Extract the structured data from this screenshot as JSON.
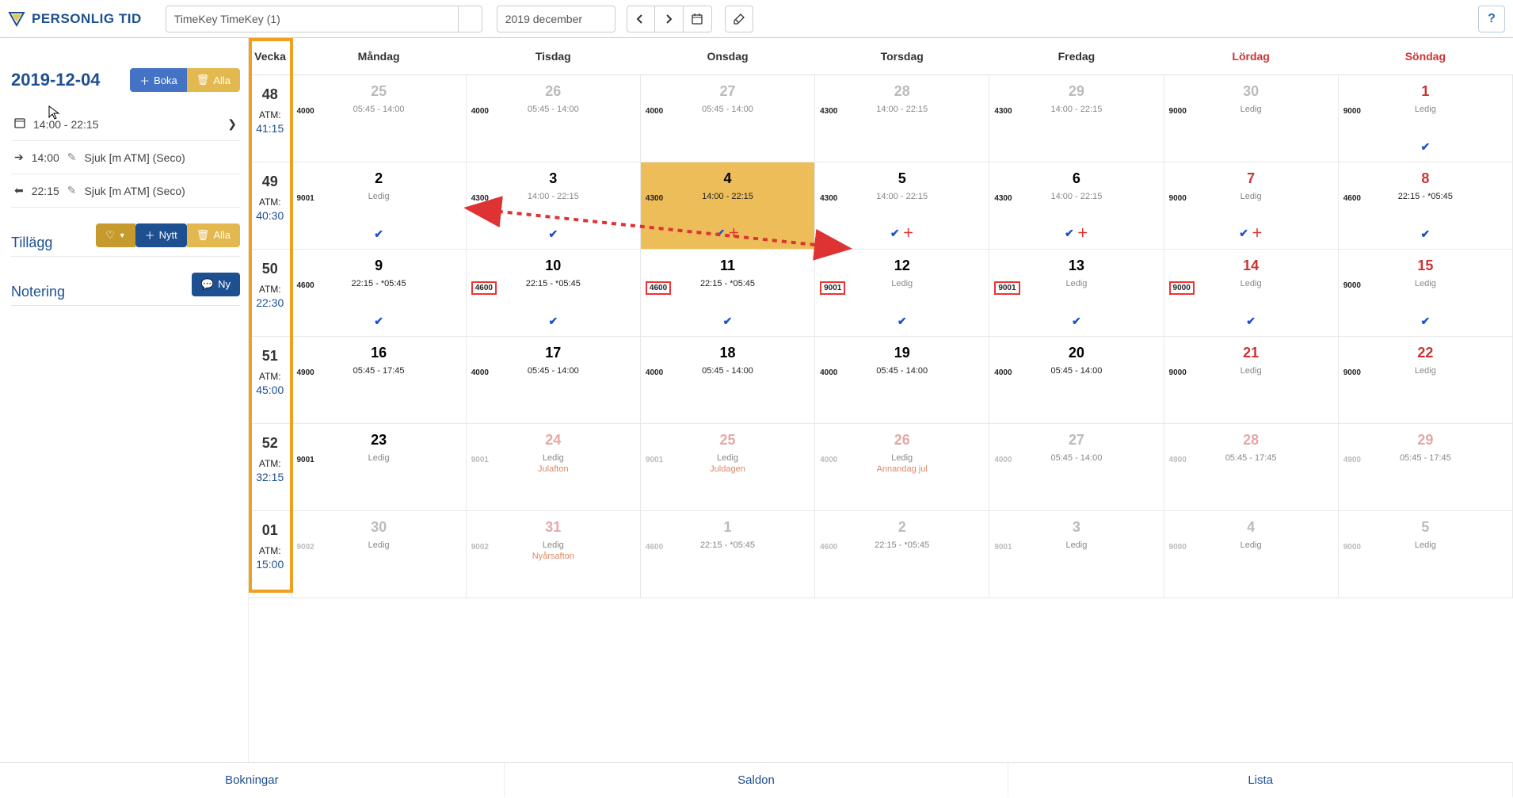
{
  "app_title": "PERSONLIG TID",
  "search_value": "TimeKey TimeKey (1)",
  "month_picker": "2019 december",
  "help_icon": "?",
  "sidebar": {
    "date": "2019-12-04",
    "boka_btn": "Boka",
    "alla_btn": "Alla",
    "schedule_row": "14:00 - 22:15",
    "in_time": "14:00",
    "in_text": "Sjuk [m ATM] (Seco)",
    "out_time": "22:15",
    "out_text": "Sjuk [m ATM] (Seco)",
    "tillagg_label": "Tillägg",
    "nytt_btn": "Nytt",
    "alla2_btn": "Alla",
    "notering_label": "Notering",
    "ny_btn": "Ny"
  },
  "headers": {
    "vecka": "Vecka",
    "days": [
      "Måndag",
      "Tisdag",
      "Onsdag",
      "Torsdag",
      "Fredag",
      "Lördag",
      "Söndag"
    ]
  },
  "weeks": [
    {
      "num": "48",
      "atm": "41:15",
      "cells": [
        {
          "day": "25",
          "dim": true,
          "code": "4000",
          "time": "05:45 - 14:00"
        },
        {
          "day": "26",
          "dim": true,
          "code": "4000",
          "time": "05:45 - 14:00"
        },
        {
          "day": "27",
          "dim": true,
          "code": "4000",
          "time": "05:45 - 14:00"
        },
        {
          "day": "28",
          "dim": true,
          "code": "4300",
          "time": "14:00 - 22:15"
        },
        {
          "day": "29",
          "dim": true,
          "code": "4300",
          "time": "14:00 - 22:15"
        },
        {
          "day": "30",
          "dim": true,
          "code": "9000",
          "time": "Ledig"
        },
        {
          "day": "1",
          "red": true,
          "code": "9000",
          "time": "Ledig",
          "check": true
        }
      ]
    },
    {
      "num": "49",
      "atm": "40:30",
      "cells": [
        {
          "day": "2",
          "code": "9001",
          "time": "Ledig",
          "check": true
        },
        {
          "day": "3",
          "code": "4300",
          "time": "14:00 - 22:15",
          "check": true
        },
        {
          "day": "4",
          "code": "4300",
          "time": "14:00 - 22:15",
          "check": true,
          "plus": true,
          "selected": true,
          "dk": true
        },
        {
          "day": "5",
          "code": "4300",
          "time": "14:00 - 22:15",
          "check": true,
          "plus": true
        },
        {
          "day": "6",
          "code": "4300",
          "time": "14:00 - 22:15",
          "check": true,
          "plus": true
        },
        {
          "day": "7",
          "red": true,
          "code": "9000",
          "time": "Ledig",
          "check": true,
          "plus": true
        },
        {
          "day": "8",
          "red": true,
          "code": "4600",
          "time": "22:15 - *05:45",
          "check": true,
          "dk": true
        }
      ]
    },
    {
      "num": "50",
      "atm": "22:30",
      "cells": [
        {
          "day": "9",
          "code": "4600",
          "time": "22:15 - *05:45",
          "check": true,
          "dk": true
        },
        {
          "day": "10",
          "code": "4600",
          "boxed": true,
          "time": "22:15 - *05:45",
          "check": true,
          "dk": true
        },
        {
          "day": "11",
          "code": "4600",
          "boxed": true,
          "time": "22:15 - *05:45",
          "check": true,
          "dk": true
        },
        {
          "day": "12",
          "code": "9001",
          "boxed": true,
          "time": "Ledig",
          "check": true
        },
        {
          "day": "13",
          "code": "9001",
          "boxed": true,
          "time": "Ledig",
          "check": true
        },
        {
          "day": "14",
          "red": true,
          "code": "9000",
          "boxed": true,
          "time": "Ledig",
          "check": true
        },
        {
          "day": "15",
          "red": true,
          "code": "9000",
          "time": "Ledig",
          "check": true
        }
      ]
    },
    {
      "num": "51",
      "atm": "45:00",
      "cells": [
        {
          "day": "16",
          "code": "4900",
          "time": "05:45 - 17:45",
          "dk": true
        },
        {
          "day": "17",
          "code": "4000",
          "time": "05:45 - 14:00",
          "dk": true
        },
        {
          "day": "18",
          "code": "4000",
          "time": "05:45 - 14:00",
          "dk": true
        },
        {
          "day": "19",
          "code": "4000",
          "time": "05:45 - 14:00",
          "dk": true
        },
        {
          "day": "20",
          "code": "4000",
          "time": "05:45 - 14:00",
          "dk": true
        },
        {
          "day": "21",
          "red": true,
          "code": "9000",
          "time": "Ledig"
        },
        {
          "day": "22",
          "red": true,
          "code": "9000",
          "time": "Ledig"
        }
      ]
    },
    {
      "num": "52",
      "atm": "32:15",
      "cells": [
        {
          "day": "23",
          "code": "9001",
          "time": "Ledig"
        },
        {
          "day": "24",
          "dimred": true,
          "code": "9001",
          "cdim": true,
          "time": "Ledig",
          "extra": "Julafton",
          "tdim": true
        },
        {
          "day": "25",
          "dimred": true,
          "code": "9001",
          "cdim": true,
          "time": "Ledig",
          "extra": "Juldagen",
          "tdim": true
        },
        {
          "day": "26",
          "dimred": true,
          "code": "4000",
          "cdim": true,
          "time": "Ledig",
          "extra": "Annandag jul",
          "tdim": true
        },
        {
          "day": "27",
          "dim": true,
          "code": "4000",
          "cdim": true,
          "time": "05:45 - 14:00"
        },
        {
          "day": "28",
          "dimred": true,
          "code": "4900",
          "cdim": true,
          "time": "05:45 - 17:45"
        },
        {
          "day": "29",
          "dimred": true,
          "code": "4900",
          "cdim": true,
          "time": "05:45 - 17:45"
        }
      ]
    },
    {
      "num": "01",
      "atm": "15:00",
      "cells": [
        {
          "day": "30",
          "dim": true,
          "code": "9002",
          "cdim": true,
          "time": "Ledig"
        },
        {
          "day": "31",
          "dimred": true,
          "code": "9002",
          "cdim": true,
          "time": "Ledig",
          "extra": "Nyårsafton",
          "tdim": true
        },
        {
          "day": "1",
          "dim": true,
          "code": "4600",
          "cdim": true,
          "time": "22:15 - *05:45"
        },
        {
          "day": "2",
          "dim": true,
          "code": "4600",
          "cdim": true,
          "time": "22:15 - *05:45"
        },
        {
          "day": "3",
          "dim": true,
          "code": "9001",
          "cdim": true,
          "time": "Ledig"
        },
        {
          "day": "4",
          "dim": true,
          "code": "9000",
          "cdim": true,
          "time": "Ledig"
        },
        {
          "day": "5",
          "dim": true,
          "code": "9000",
          "cdim": true,
          "time": "Ledig"
        }
      ]
    }
  ],
  "footer": {
    "t1": "Bokningar",
    "t2": "Saldon",
    "t3": "Lista"
  },
  "atm_label": "ATM:"
}
